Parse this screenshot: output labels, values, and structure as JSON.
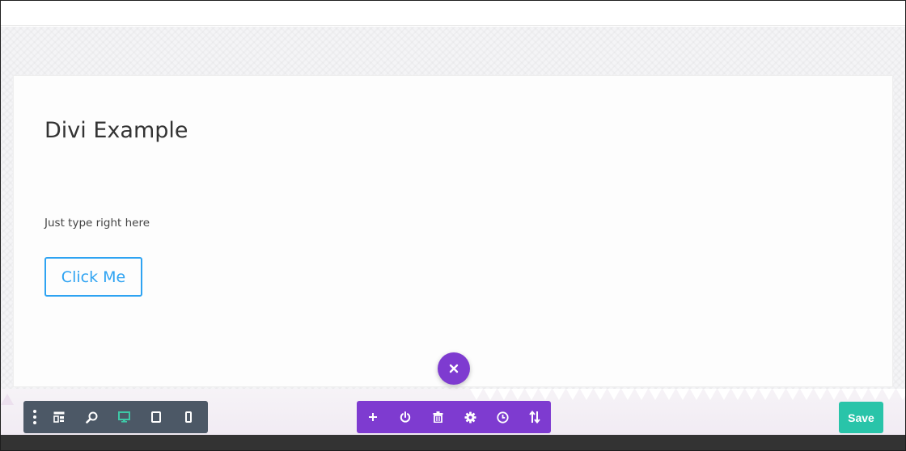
{
  "page": {
    "title": "Divi Example",
    "body_text": "Just type right here",
    "button_label": "Click Me"
  },
  "builder": {
    "save_label": "Save",
    "left_toolbar": {
      "items": [
        "menu-icon",
        "wireframe-icon",
        "zoom-icon",
        "desktop-icon",
        "tablet-icon",
        "phone-icon"
      ],
      "active": "desktop-icon"
    },
    "center_toolbar": {
      "items": [
        "add-icon",
        "power-icon",
        "trash-icon",
        "settings-icon",
        "history-icon",
        "sort-icon"
      ]
    },
    "close_icon": "close-icon"
  },
  "colors": {
    "accent_purple": "#7e3bd0",
    "toolbar_gray": "#4c5866",
    "save_green": "#29c4a9",
    "link_blue": "#2ea3f2",
    "active_icon": "#3ec7a6"
  }
}
